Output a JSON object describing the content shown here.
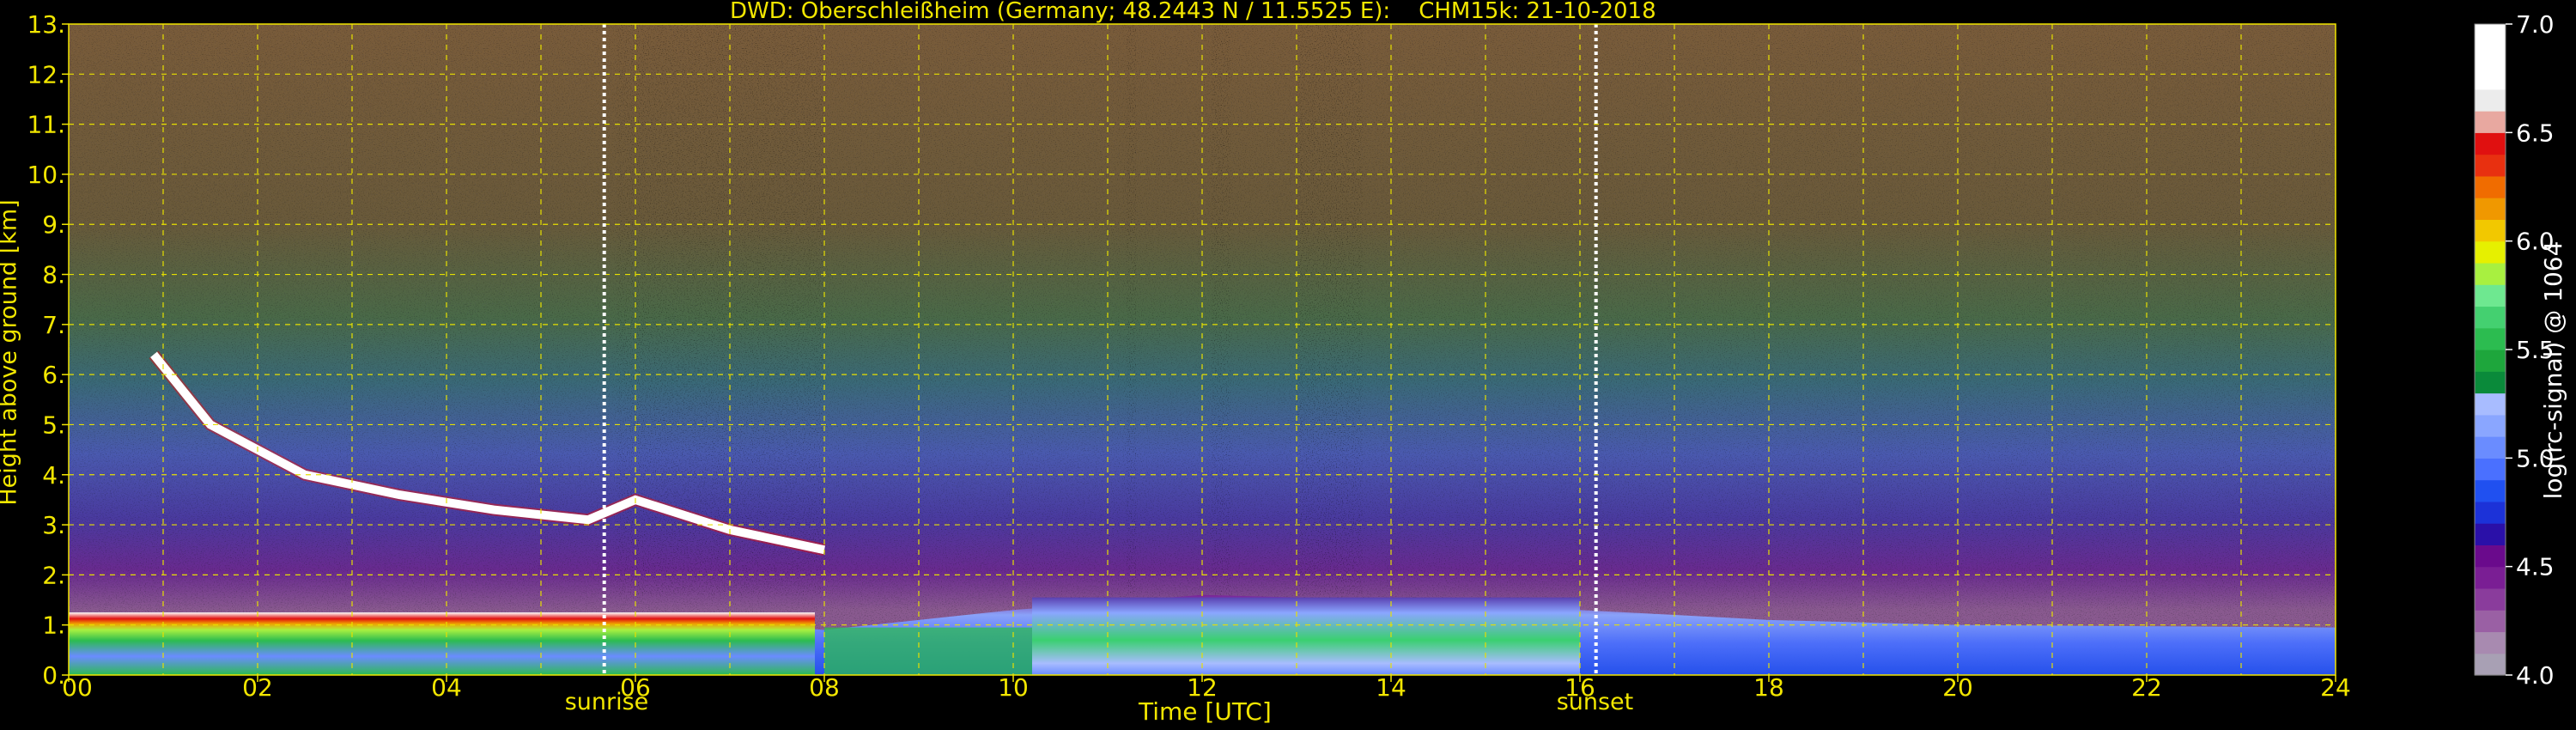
{
  "chart_data": {
    "type": "heatmap",
    "title": "DWD: Oberschleißheim (Germany; 48.2443 N / 11.5525 E):    CHM15k: 21-10-2018",
    "xlabel": "Time [UTC]",
    "ylabel": "Height above ground [km]",
    "x_ticks": [
      "00",
      "02",
      "04",
      "06",
      "08",
      "10",
      "12",
      "14",
      "16",
      "18",
      "20",
      "22",
      "24"
    ],
    "y_ticks": [
      "0.",
      "1.",
      "2.",
      "3.",
      "4.",
      "5.",
      "6.",
      "7.",
      "8.",
      "9.",
      "10.",
      "11.",
      "12.",
      "13."
    ],
    "xlim": [
      0,
      24
    ],
    "ylim": [
      0,
      13
    ],
    "grid": true,
    "colorbar": {
      "label": "log(rc-signal) @ 1064 nm",
      "range": [
        4.0,
        7.0
      ],
      "ticks": [
        "4.0",
        "4.5",
        "5.0",
        "5.5",
        "6.0",
        "6.5",
        "7.0"
      ],
      "colors": [
        "#a8a0b4",
        "#a88ab0",
        "#9a60a4",
        "#8a3c9c",
        "#7a1e94",
        "#6a0a8c",
        "#2a10a8",
        "#1c32d8",
        "#2050f0",
        "#4a70ff",
        "#6a8cff",
        "#8aa6ff",
        "#a8bcff",
        "#0a8a3a",
        "#1ea63c",
        "#2cbc50",
        "#44d070",
        "#6ee890",
        "#a8f040",
        "#e6f000",
        "#f2c800",
        "#f09800",
        "#f06c00",
        "#e83010",
        "#e01010",
        "#e8a8a0",
        "#ececec",
        "#ffffff",
        "#ffffff",
        "#ffffff"
      ]
    },
    "annotations": [
      {
        "text": "sunrise",
        "x": 5.67
      },
      {
        "text": "sunset",
        "x": 16.17
      }
    ],
    "cloud_layer": [
      [
        0.9,
        6.4
      ],
      [
        1.5,
        5.0
      ],
      [
        2.5,
        4.0
      ],
      [
        3.5,
        3.6
      ],
      [
        4.5,
        3.3
      ],
      [
        5.5,
        3.1
      ],
      [
        6.0,
        3.5
      ],
      [
        7.0,
        2.9
      ],
      [
        8.0,
        2.5
      ]
    ],
    "boundary_layer_top": [
      [
        0,
        1.1
      ],
      [
        4,
        1.25
      ],
      [
        6,
        1.2
      ],
      [
        8,
        0.9
      ],
      [
        10,
        1.3
      ],
      [
        12,
        1.6
      ],
      [
        14,
        1.5
      ],
      [
        16,
        1.3
      ],
      [
        18,
        1.1
      ],
      [
        20,
        1.0
      ],
      [
        24,
        0.95
      ]
    ]
  }
}
